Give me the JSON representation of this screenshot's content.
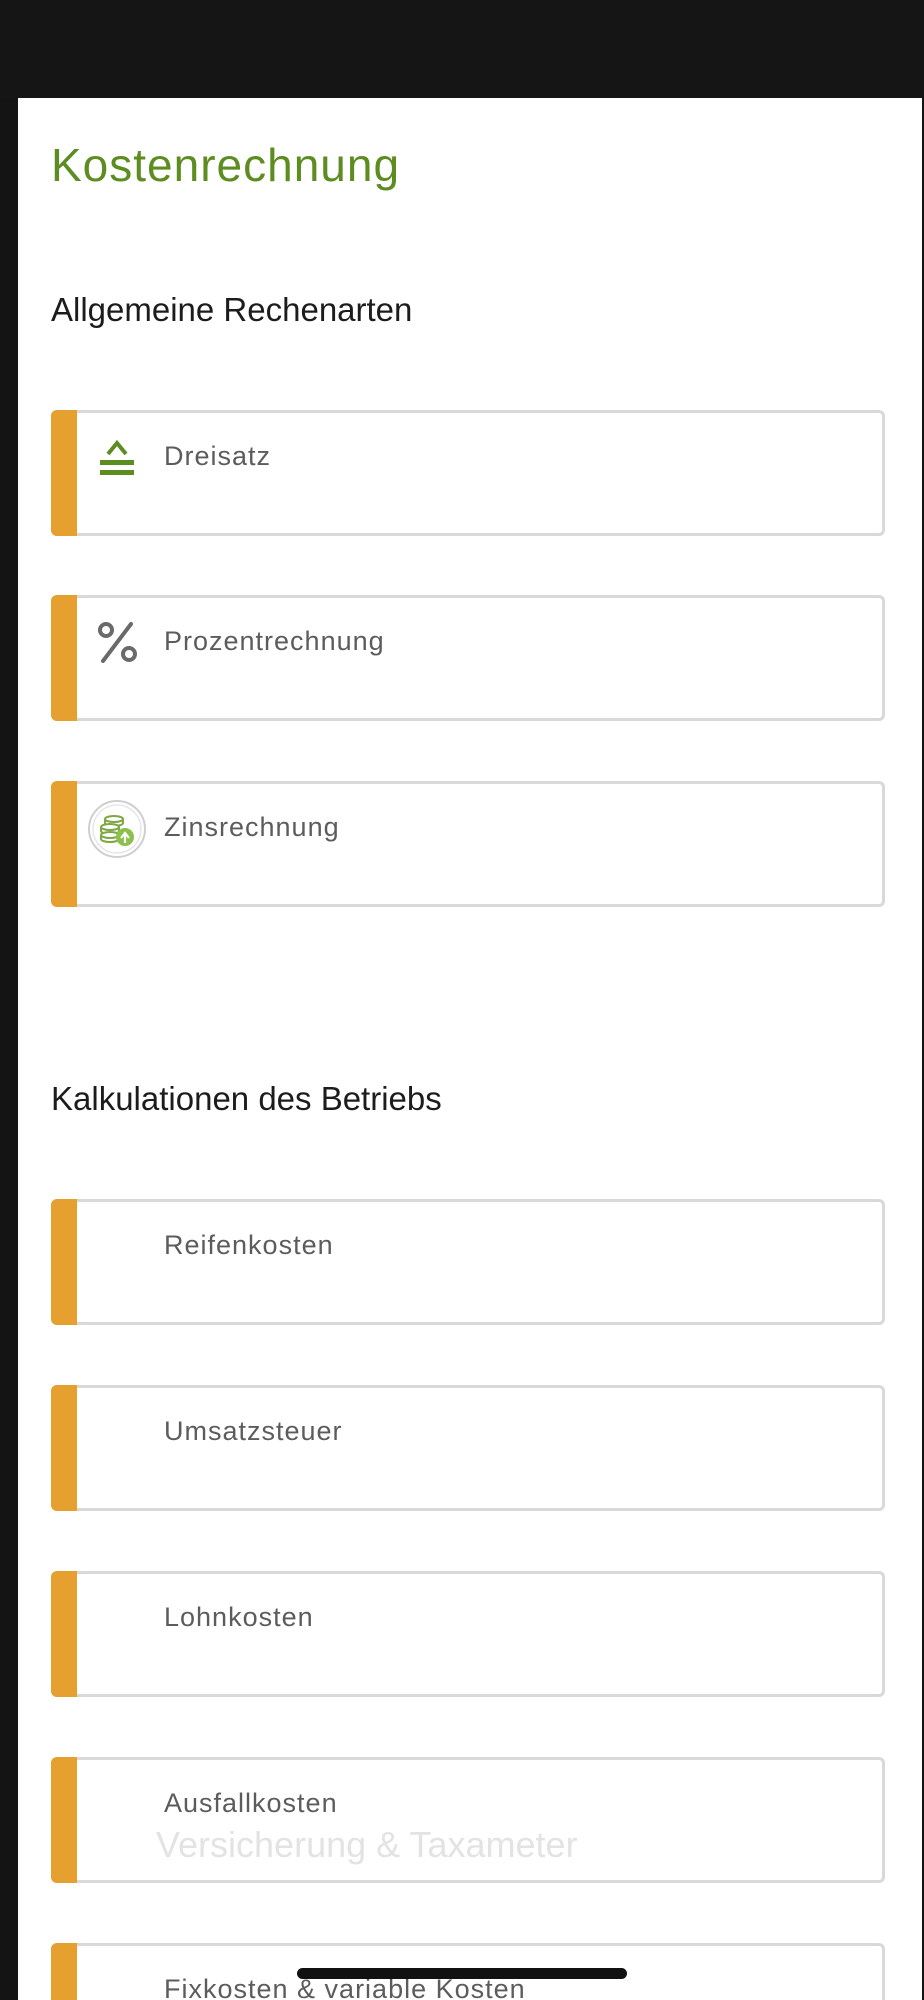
{
  "header": {
    "title": "Kostenrechnung"
  },
  "sections": [
    {
      "heading": "Allgemeine Rechenarten",
      "items": [
        {
          "label": "Dreisatz",
          "icon": "equal-triangle-icon"
        },
        {
          "label": "Prozentrechnung",
          "icon": "percent-icon"
        },
        {
          "label": "Zinsrechnung",
          "icon": "coins-growth-icon"
        }
      ]
    },
    {
      "heading": "Kalkulationen des Betriebs",
      "items": [
        {
          "label": "Reifenkosten"
        },
        {
          "label": "Umsatzsteuer"
        },
        {
          "label": "Lohnkosten"
        },
        {
          "label": "Ausfallkosten",
          "sublabel": "Versicherung & Taxameter"
        },
        {
          "label": "Fixkosten & variable Kosten"
        }
      ]
    }
  ],
  "colors": {
    "title": "#5d8d21",
    "accent": "#e5a030",
    "icon_green": "#5d8d21",
    "card_border": "#d9d9d9"
  }
}
